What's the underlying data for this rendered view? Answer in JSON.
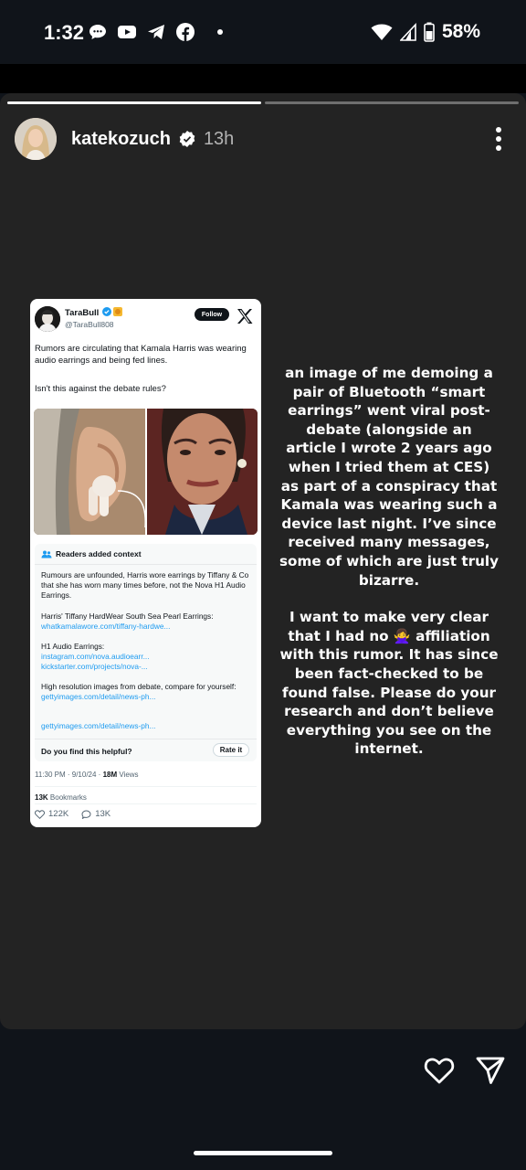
{
  "status_bar": {
    "time": "1:32",
    "battery": "58%",
    "notification_icons": [
      "chat-bubble-icon",
      "youtube-icon",
      "telegram-icon",
      "facebook-icon"
    ]
  },
  "story": {
    "username": "katekozuch",
    "time_ago": "13h",
    "progress_segments": [
      1,
      0
    ]
  },
  "tweet": {
    "name": "TaraBull",
    "handle": "@TaraBull808",
    "follow_label": "Follow",
    "text_line1": "Rumors are circulating that Kamala Harris was wearing audio earrings and being fed lines.",
    "text_line2": "Isn't this against the debate rules?",
    "context_title": "Readers added context",
    "context_p1": "Rumours are unfounded, Harris wore earrings by Tiffany & Co that she has worn many times before, not the Nova H1 Audio Earrings.",
    "context_p2_label": "Harris' Tiffany HardWear South Sea Pearl Earrings:",
    "context_p2_link": "whatkamalawore.com/tiffany-hardwe...",
    "context_p3_label": "H1 Audio Earrings:",
    "context_p3_link1": "instagram.com/nova.audioearr...",
    "context_p3_link2": "kickstarter.com/projects/nova-...",
    "context_p4_label": "High resolution images from debate, compare for yourself:",
    "context_p4_link": "gettyimages.com/detail/news-ph...",
    "context_p5_link": "gettyimages.com/detail/news-ph...",
    "helpful_q": "Do you find this helpful?",
    "rate_label": "Rate it",
    "timestamp": "11:30 PM · 9/10/24 · ",
    "views_count": "18M",
    "views_label": " Views",
    "bookmarks_count": "13K",
    "bookmarks_label": " Bookmarks",
    "likes": "122K",
    "replies": "13K"
  },
  "caption": {
    "p1": "an image of me demoing a pair of Bluetooth “smart earrings” went viral post-debate (alongside an article I wrote 2 years ago when I tried them at CES) as part of a conspiracy that Kamala was wearing such a device last night. I’ve since received many messages, some of which are just truly bizarre.",
    "p2_before": "I want to make very clear that I had no ",
    "p2_emoji": "🙅‍♀️",
    "p2_after": " affiliation with this rumor. It has since been fact-checked to be found false. Please do your research and don’t believe everything you see on the internet."
  }
}
